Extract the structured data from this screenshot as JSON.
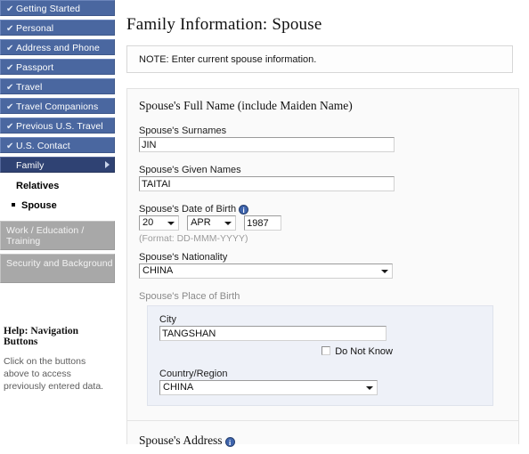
{
  "sidebar": {
    "nav_items": [
      {
        "label": "Getting Started",
        "state": "complete",
        "check": "✔"
      },
      {
        "label": "Personal",
        "state": "complete",
        "check": "✔"
      },
      {
        "label": "Address and Phone",
        "state": "complete",
        "check": "✔"
      },
      {
        "label": "Passport",
        "state": "complete",
        "check": "✔"
      },
      {
        "label": "Travel",
        "state": "complete",
        "check": "✔"
      },
      {
        "label": "Travel Companions",
        "state": "complete",
        "check": "✔"
      },
      {
        "label": "Previous U.S. Travel",
        "state": "complete",
        "check": "✔"
      },
      {
        "label": "U.S. Contact",
        "state": "complete",
        "check": "✔"
      },
      {
        "label": "Family",
        "state": "active",
        "check": ""
      }
    ],
    "sub_items": [
      {
        "label": "Relatives",
        "current": false
      },
      {
        "label": "Spouse",
        "current": true
      }
    ],
    "disabled_items": [
      {
        "label": "Work / Education / Training"
      },
      {
        "label": "Security and Background"
      }
    ],
    "help": {
      "title": "Help: Navigation Buttons",
      "text": "Click on the buttons above to access previously entered data."
    }
  },
  "main": {
    "page_title": "Family Information: Spouse",
    "note": "NOTE: Enter current spouse information.",
    "section_heading": "Spouse's Full Name (include Maiden Name)",
    "fields": {
      "surnames": {
        "label": "Spouse's Surnames",
        "value": "JIN"
      },
      "given_names": {
        "label": "Spouse's Given Names",
        "value": "TAITAI"
      },
      "dob": {
        "label": "Spouse's Date of Birth",
        "day": "20",
        "month": "APR",
        "year": "1987",
        "format_hint": "(Format: DD-MMM-YYYY)",
        "info_glyph": "i"
      },
      "nationality": {
        "label": "Spouse's Nationality",
        "value": "CHINA"
      },
      "place_of_birth": {
        "label": "Spouse's Place of Birth",
        "city": {
          "label": "City",
          "value": "TANGSHAN"
        },
        "do_not_know": {
          "label": "Do Not Know",
          "checked": false
        },
        "country": {
          "label": "Country/Region",
          "value": "CHINA"
        }
      }
    },
    "next_section_heading": "Spouse's Address",
    "next_section_info_glyph": "i"
  },
  "colors": {
    "nav_blue": "#4a67a0",
    "nav_active": "#2f4273",
    "nav_disabled": "#a8a8a8",
    "panel_bg": "#fafafa",
    "inner_panel_bg": "#eef1f8",
    "info_icon": "#3e64ad"
  }
}
